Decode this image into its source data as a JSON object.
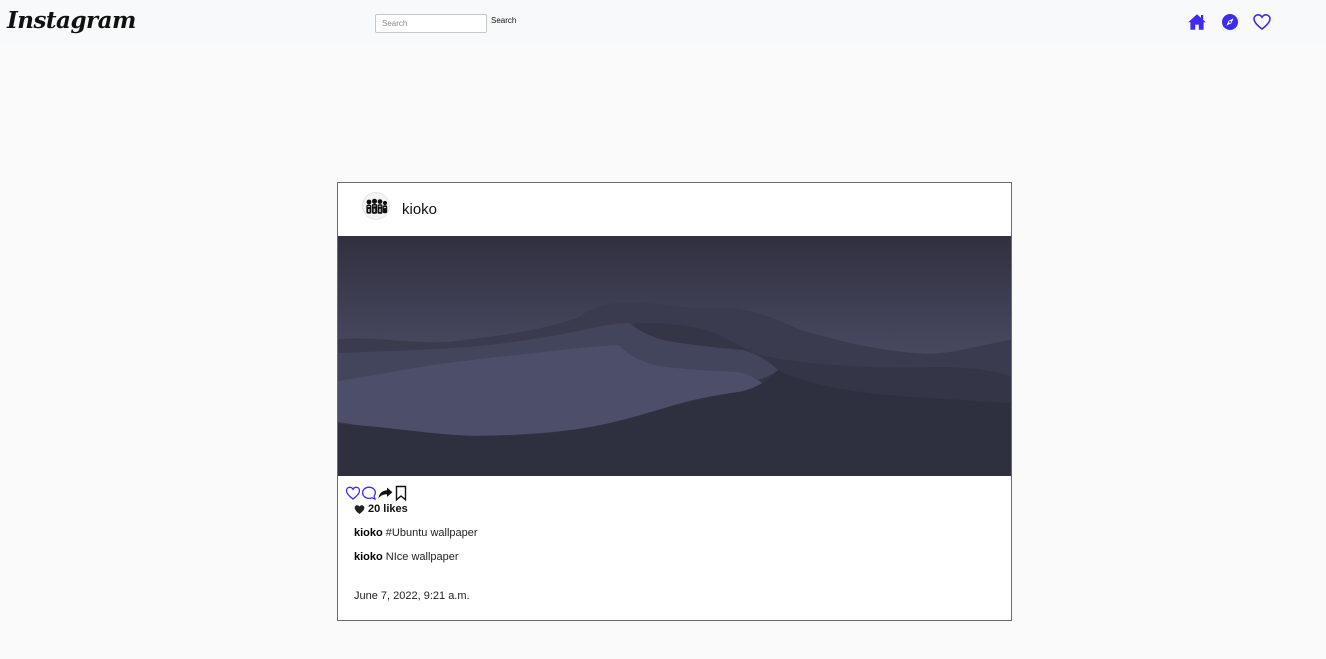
{
  "navbar": {
    "brand": "Instagram",
    "search_placeholder": "Search",
    "search_button": "Search",
    "accent_color": "#3d2bf0",
    "icons": [
      "home-icon",
      "compass-icon",
      "heart-outline-icon"
    ]
  },
  "post": {
    "username": "kioko",
    "likes_text": "20 likes",
    "actions": [
      "heart-outline-icon",
      "comment-icon",
      "share-icon",
      "bookmark-icon"
    ],
    "caption": {
      "user": "kioko",
      "text": "#Ubuntu wallpaper"
    },
    "comments": [
      {
        "user": "kioko",
        "text": "NIce wallpaper"
      }
    ],
    "timestamp": "June 7, 2022, 9:21 a.m."
  }
}
